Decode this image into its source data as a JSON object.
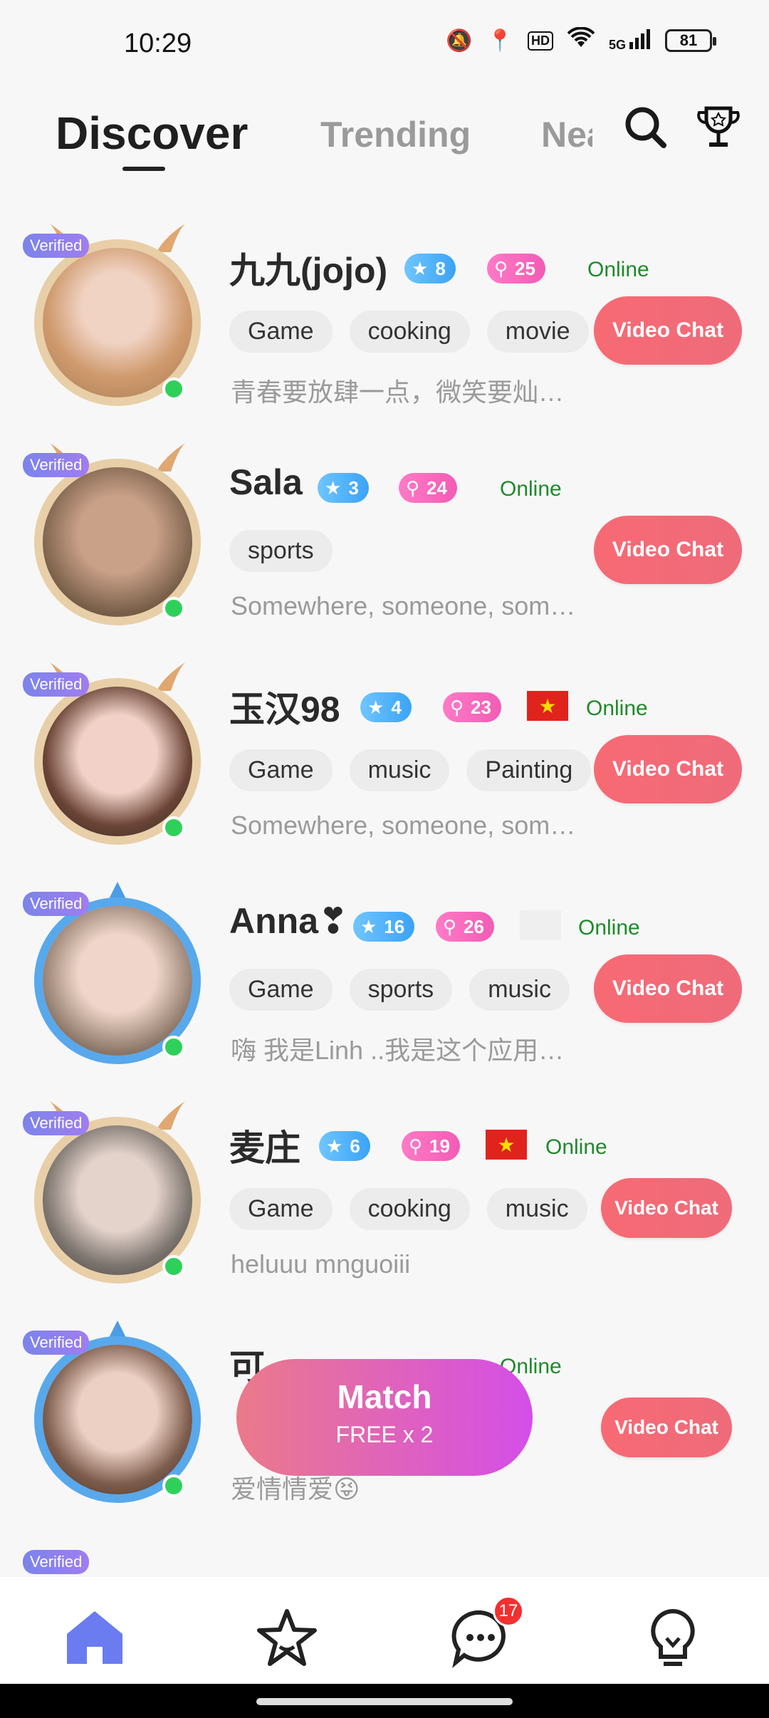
{
  "status_bar": {
    "time": "10:29",
    "battery": "81",
    "hd": "HD",
    "network": "5G"
  },
  "tabs": [
    {
      "label": "Discover",
      "active": true
    },
    {
      "label": "Trending",
      "active": false
    },
    {
      "label": "Nearby",
      "active": false
    }
  ],
  "users": [
    {
      "verified": "Verified",
      "name": "九九(jojo)",
      "level": "8",
      "charm": "25",
      "flag": "",
      "status": "Online",
      "tags": [
        "Game",
        "cooking",
        "movie"
      ],
      "bio": "青春要放肆一点，微笑要灿…",
      "action": "Video Chat",
      "face": "#e9c3ad"
    },
    {
      "verified": "Verified",
      "name": "Sala",
      "level": "3",
      "charm": "24",
      "flag": "",
      "status": "Online",
      "tags": [
        "sports"
      ],
      "bio": "Somewhere, someone, som…",
      "action": "Video Chat",
      "face": "#b7937a"
    },
    {
      "verified": "Verified",
      "name": "玉汉98",
      "level": "4",
      "charm": "23",
      "flag": "★",
      "status": "Online",
      "tags": [
        "Game",
        "music",
        "Painting"
      ],
      "bio": "Somewhere, someone, som…",
      "action": "Video Chat",
      "face": "#e7c0b4"
    },
    {
      "verified": "Verified",
      "name": "Anna❣",
      "level": "16",
      "charm": "26",
      "flag": "",
      "status": "Online",
      "tags": [
        "Game",
        "sports",
        "music"
      ],
      "bio": "嗨 我是Linh ..我是这个应用…",
      "action": "Video Chat",
      "face": "#d7b6a5"
    },
    {
      "verified": "Verified",
      "name": "麦庄",
      "level": "6",
      "charm": "19",
      "flag": "★",
      "status": "Online",
      "tags": [
        "Game",
        "cooking",
        "music"
      ],
      "bio": "heluuu mnguoiii",
      "action": "Video Chat",
      "face": "#a39a92"
    },
    {
      "verified": "Verified",
      "name": "可",
      "level": "",
      "charm": "",
      "flag": "",
      "status": "Online",
      "tags": [],
      "bio": "爱情情爱😝",
      "action": "Video Chat",
      "face": "#caa899"
    }
  ],
  "partial_row": {
    "verified": "Verified"
  },
  "match_button": {
    "title": "Match",
    "subtitle": "FREE x 2"
  },
  "bottom_nav": {
    "items": [
      "home-icon",
      "star-icon",
      "chat-icon",
      "bulb-icon"
    ],
    "unread": "17"
  }
}
